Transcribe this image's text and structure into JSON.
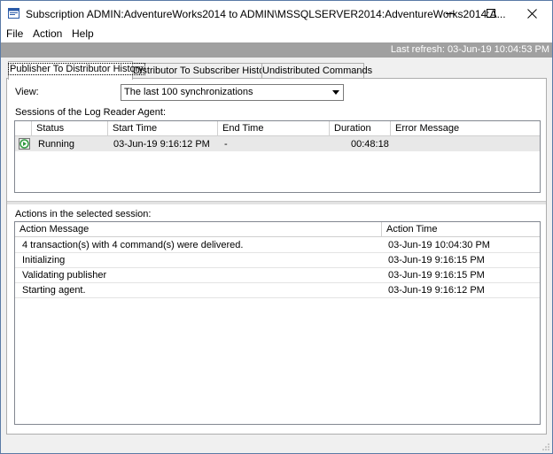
{
  "window": {
    "title": "Subscription ADMIN:AdventureWorks2014 to ADMIN\\MSSQLSERVER2014:AdventureWorks2014:A...",
    "icon": "replication-monitor-icon"
  },
  "menu": {
    "file": "File",
    "action": "Action",
    "help": "Help"
  },
  "refresh": "Last refresh: 03-Jun-19 10:04:53 PM",
  "tabs": [
    {
      "label": "Publisher To Distributor History"
    },
    {
      "label": "Distributor To Subscriber History"
    },
    {
      "label": "Undistributed Commands"
    }
  ],
  "view": {
    "label": "View:",
    "value": "The last 100 synchronizations"
  },
  "sessions": {
    "label": "Sessions of the Log Reader Agent:",
    "columns": [
      "Status",
      "Start Time",
      "End Time",
      "Duration",
      "Error Message"
    ],
    "rows": [
      {
        "status": "Running",
        "start": "03-Jun-19 9:16:12 PM",
        "end": "-",
        "duration": "00:48:18",
        "error": ""
      }
    ]
  },
  "actions": {
    "label": "Actions in the selected session:",
    "columns": [
      "Action Message",
      "Action Time"
    ],
    "rows": [
      {
        "message": "4 transaction(s) with 4 command(s) were delivered.",
        "time": "03-Jun-19 10:04:30 PM"
      },
      {
        "message": "Initializing",
        "time": "03-Jun-19 9:16:15 PM"
      },
      {
        "message": "Validating publisher",
        "time": "03-Jun-19 9:16:15 PM"
      },
      {
        "message": "Starting agent.",
        "time": "03-Jun-19 9:16:12 PM"
      }
    ]
  },
  "colors": {
    "refresh_bar": "#a0a0a0",
    "selected_row": "#e8e8e8",
    "running_icon": "#2e9a3e"
  }
}
